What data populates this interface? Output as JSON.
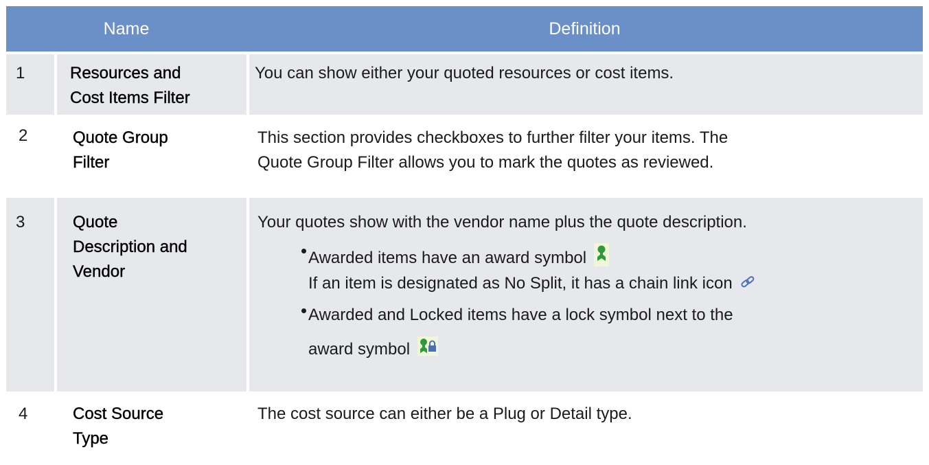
{
  "header": {
    "name_label": "Name",
    "definition_label": "Definition"
  },
  "rows": [
    {
      "num": "1",
      "name_lines": [
        "Resources and",
        "Cost Items Filter"
      ],
      "definition": "You can show either your quoted resources or cost items."
    },
    {
      "num": "2",
      "name_lines": [
        "Quote Group",
        "Filter"
      ],
      "definition_lines": [
        "This section provides checkboxes to further filter your items. The",
        "Quote Group Filter allows you to mark the quotes as reviewed."
      ]
    },
    {
      "num": "3",
      "name_lines": [
        "Quote",
        "Description and",
        "Vendor"
      ],
      "definition": "Your quotes show with the vendor name plus the quote description.",
      "bullets": [
        {
          "line1": "Awarded items have an award symbol",
          "line1_icon": "award-ribbon-icon",
          "line2": "If an item is designated as No Split, it has a chain link icon",
          "line2_icon": "chain-link-icon"
        },
        {
          "line1": "Awarded and Locked items have a lock symbol next to the",
          "line2": "award symbol",
          "line2_icon": "award-lock-icon"
        }
      ]
    },
    {
      "num": "4",
      "name_lines": [
        "Cost Source",
        "Type"
      ],
      "definition": "The cost source can either be a Plug or Detail type."
    }
  ],
  "colors": {
    "header_bg": "#6b8fc7",
    "row_shade": "#e6e8eb",
    "award_green": "#2e9a3a",
    "link_blue": "#4a6fb5"
  }
}
